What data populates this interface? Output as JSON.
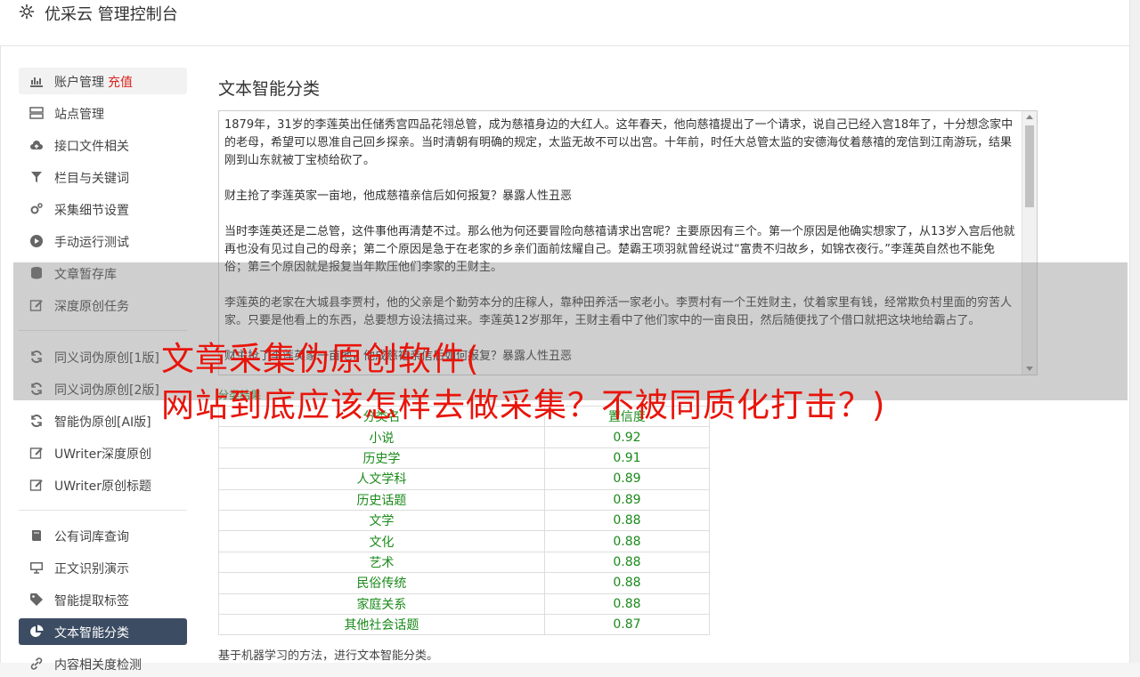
{
  "header": {
    "title": "优采云 管理控制台",
    "icon": "gear-icon"
  },
  "sidebar": {
    "items": [
      {
        "label": "账户管理",
        "badge": "充值",
        "icon": "bar-chart-icon"
      },
      {
        "label": "站点管理",
        "icon": "server-icon"
      },
      {
        "label": "接口文件相关",
        "icon": "cloud-upload-icon"
      },
      {
        "label": "栏目与关键词",
        "icon": "filter-icon"
      },
      {
        "label": "采集细节设置",
        "icon": "cogs-icon"
      },
      {
        "label": "手动运行测试",
        "icon": "play-circle-icon"
      },
      {
        "label": "文章暂存库",
        "icon": "database-icon"
      },
      {
        "label": "深度原创任务",
        "icon": "edit-icon"
      },
      {
        "label": "同义词伪原创[1版]",
        "icon": "refresh-icon"
      },
      {
        "label": "同义词伪原创[2版]",
        "icon": "refresh-icon"
      },
      {
        "label": "智能伪原创[AI版]",
        "icon": "refresh-icon"
      },
      {
        "label": "UWriter深度原创",
        "icon": "edit-icon"
      },
      {
        "label": "UWriter原创标题",
        "icon": "edit-icon"
      },
      {
        "label": "公有词库查询",
        "icon": "book-icon"
      },
      {
        "label": "正文识别演示",
        "icon": "monitor-icon"
      },
      {
        "label": "智能提取标签",
        "icon": "tag-icon"
      },
      {
        "label": "文本智能分类",
        "icon": "pie-chart-icon"
      },
      {
        "label": "内容相关度检测",
        "icon": "link-icon"
      }
    ]
  },
  "main": {
    "title": "文本智能分类",
    "text_paragraphs": [
      "1879年，31岁的李莲英出任储秀宫四品花翎总管，成为慈禧身边的大红人。这年春天，他向慈禧提出了一个请求，说自己已经入宫18年了，十分想念家中的老母，希望可以恩准自己回乡探亲。当时清朝有明确的规定，太监无故不可以出宫。十年前，时任大总管太监的安德海仗着慈禧的宠信到江南游玩，结果刚到山东就被丁宝桢给砍了。",
      "财主抢了李莲英家一亩地，他成慈禧亲信后如何报复？暴露人性丑恶",
      "当时李莲英还是二总管，这件事他再清楚不过。那么他为何还要冒险向慈禧请求出宫呢？主要原因有三个。第一个原因是他确实想家了，从13岁入宫后他就再也没有见过自己的母亲；第二个原因是急于在老家的乡亲们面前炫耀自己。楚霸王项羽就曾经说过“富贵不归故乡，如锦衣夜行。”李莲英自然也不能免俗；第三个原因就是报复当年欺压他们李家的王财主。",
      "李莲英的老家在大城县李贾村，他的父亲是个勤劳本分的庄稼人，靠种田养活一家老小。李贾村有一个王姓财主，仗着家里有钱，经常欺负村里面的穷苦人家。只要是他看上的东西，总要想方设法搞过来。李莲英12岁那年，王财主看中了他们家中的一亩良田，然后随便找了个借口就把这块地给霸占了。",
      "财主抢了李莲英家一亩地，他成慈禧亲信后如何报复？暴露人性丑恶"
    ],
    "result_label": "分类结果",
    "table": {
      "headers": [
        "分类名",
        "置信度"
      ],
      "rows": [
        [
          "小说",
          "0.92"
        ],
        [
          "历史学",
          "0.91"
        ],
        [
          "人文学科",
          "0.89"
        ],
        [
          "历史话题",
          "0.89"
        ],
        [
          "文学",
          "0.88"
        ],
        [
          "文化",
          "0.88"
        ],
        [
          "艺术",
          "0.88"
        ],
        [
          "民俗传统",
          "0.88"
        ],
        [
          "家庭关系",
          "0.88"
        ],
        [
          "其他社会话题",
          "0.87"
        ]
      ]
    },
    "footnote": "基于机器学习的方法，进行文本智能分类。"
  },
  "overlay": {
    "line1": "文章采集伪原创软件(",
    "line2": "网站到底应该怎样去做采集？不被同质化打击？)"
  },
  "colors": {
    "accent_active": "#3c4c63",
    "recharge": "#d9241c",
    "result_green": "#1a8a1a",
    "headline_red": "#e8150b"
  }
}
